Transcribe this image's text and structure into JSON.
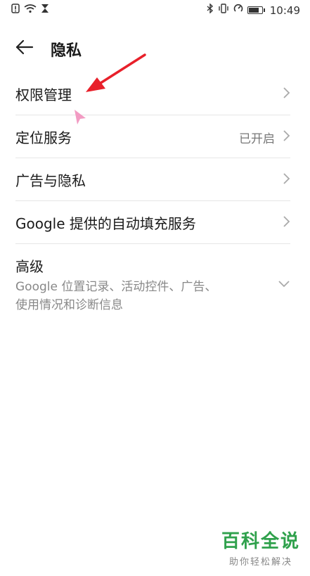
{
  "status_bar": {
    "time": "10:49",
    "left_icons": [
      "alert-icon",
      "wifi-icon",
      "hourglass-icon"
    ],
    "right_icons": [
      "bluetooth-icon",
      "vibrate-icon",
      "data-saver-icon",
      "battery-icon"
    ]
  },
  "header": {
    "title": "隐私"
  },
  "list": {
    "items": [
      {
        "label": "权限管理",
        "value": ""
      },
      {
        "label": "定位服务",
        "value": "已开启"
      },
      {
        "label": "广告与隐私",
        "value": ""
      },
      {
        "label": "Google 提供的自动填充服务",
        "value": ""
      }
    ],
    "advanced": {
      "label": "高级",
      "description": "Google 位置记录、活动控件、广告、使用情况和诊断信息"
    }
  },
  "watermark": {
    "title": "百科全说",
    "subtitle": "助你轻松解决"
  },
  "colors": {
    "annotation_arrow": "#e8202a",
    "watermark_green": "#2fa14c",
    "cursor_pink": "#f29bc3"
  }
}
